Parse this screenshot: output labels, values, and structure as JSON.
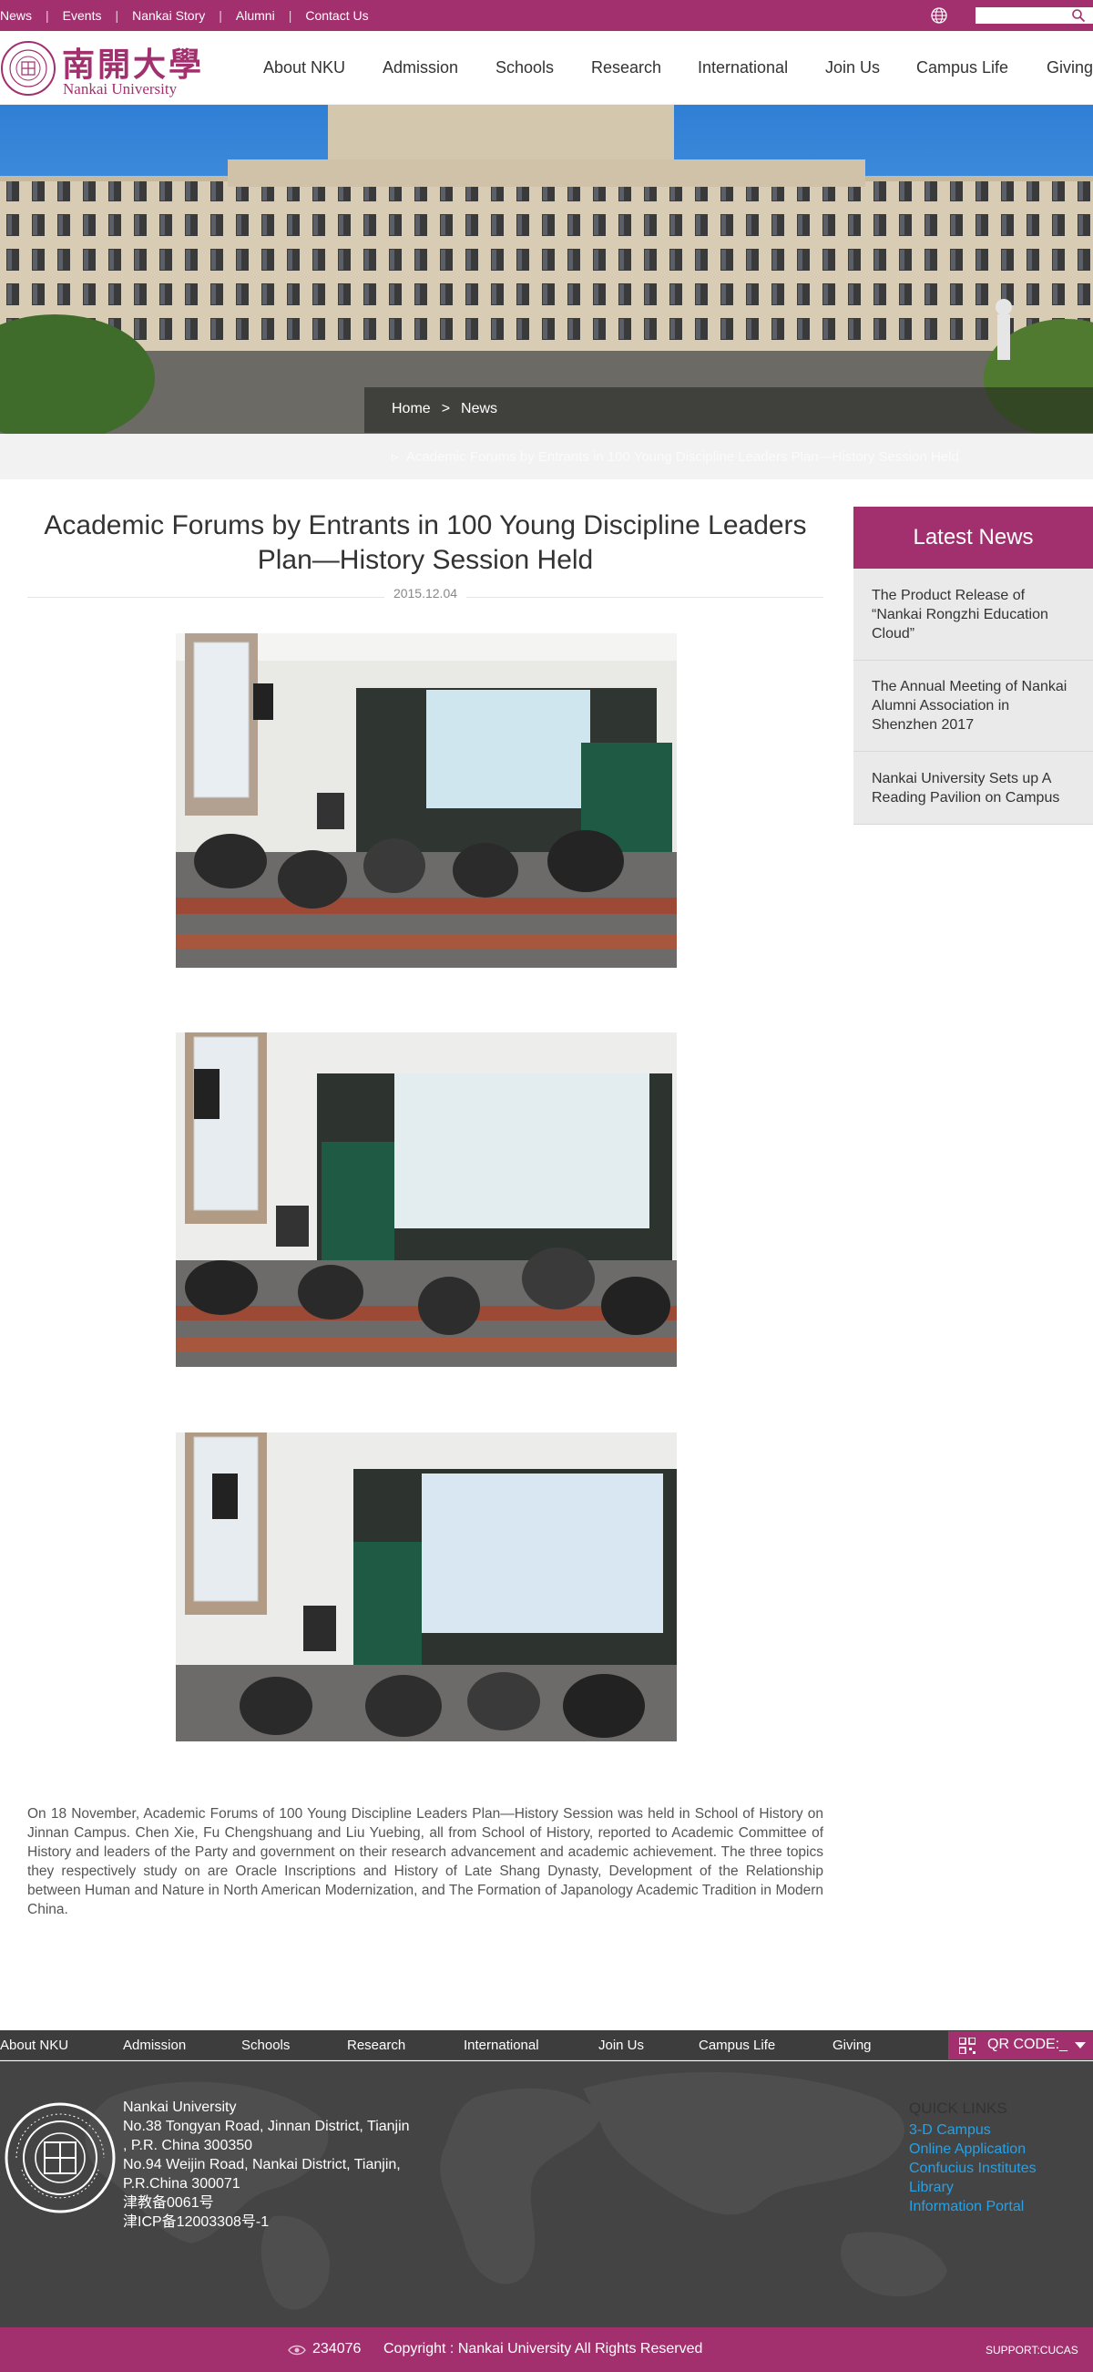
{
  "topbar": {
    "links": [
      "News",
      "Events",
      "Nankai Story",
      "Alumni",
      "Contact Us"
    ],
    "search_placeholder": ""
  },
  "header": {
    "logo_cn": "南開大學",
    "logo_en": "Nankai University",
    "nav": [
      "About NKU",
      "Admission",
      "Schools",
      "Research",
      "International",
      "Join Us",
      "Campus Life",
      "Giving"
    ]
  },
  "breadcrumb": {
    "home": "Home",
    "sep": ">",
    "current": "News"
  },
  "subbar_text": "Academic Forums by Entrants in 100 Young Discipline Leaders Plan—History Session Held",
  "article": {
    "title": "Academic Forums by Entrants in 100 Young Discipline Leaders Plan—History Session Held",
    "date": "2015.12.04",
    "body": "On 18 November, Academic Forums of 100 Young Discipline Leaders Plan—History Session was held in School of History on Jinnan Campus. Chen Xie, Fu Chengshuang and Liu Yuebing, all from School of History, reported to Academic Committee of History and leaders of the Party and government on their research advancement and academic achievement. The three topics they respectively study on are Oracle Inscriptions and History of Late Shang Dynasty, Development of the Relationship between Human and Nature in North American Modernization, and The Formation of Japanology Academic Tradition in Modern China."
  },
  "sidebar": {
    "heading": "Latest News",
    "items": [
      "The Product Release of “Nankai Rongzhi Education Cloud”",
      "The Annual Meeting of Nankai Alumni Association in Shenzhen 2017",
      "Nankai University Sets up A Reading Pavilion on Campus"
    ]
  },
  "footer": {
    "nav": [
      "About NKU",
      "Admission",
      "Schools",
      "Research",
      "International",
      "Join Us",
      "Campus Life",
      "Giving"
    ],
    "qr_label": "QR CODE:_",
    "address_lines": [
      "Nankai University",
      "No.38 Tongyan Road, Jinnan District, Tianjin",
      ", P.R. China 300350",
      "No.94 Weijin Road,  Nankai District, Tianjin,",
      "P.R.China  300071",
      "津教备0061号",
      "津ICP备12003308号-1"
    ],
    "quick_links_title": "QUICK LINKS",
    "quick_links": [
      "3-D Campus",
      "Online Application",
      "Confucius Institutes",
      "Library",
      "Information Portal"
    ],
    "visits": "234076",
    "copyright": "Copyright : Nankai University All Rights Reserved",
    "support": "SUPPORT:CUCAS"
  },
  "colors": {
    "brand": "#a2306e",
    "footer_bg": "#444444",
    "link": "#27a1e5"
  },
  "icons": [
    "globe-icon",
    "search-icon",
    "qr-code-icon",
    "chevron-down-icon",
    "eye-icon"
  ]
}
